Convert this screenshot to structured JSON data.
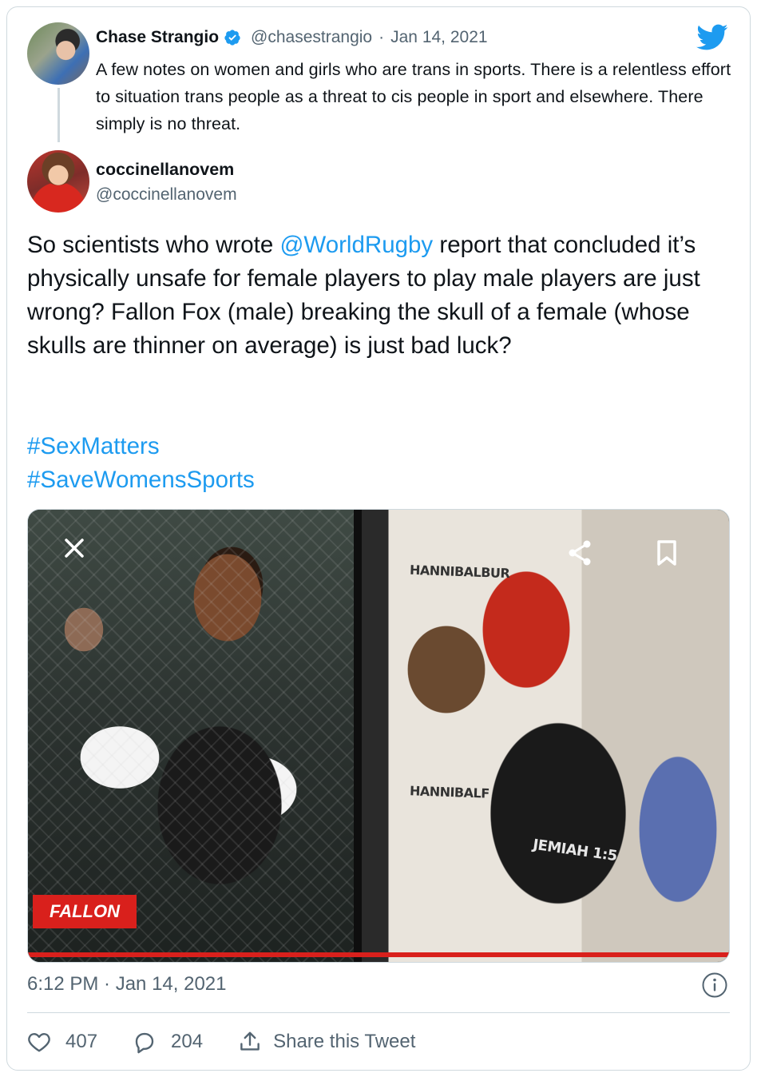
{
  "parent_tweet": {
    "author_name": "Chase Strangio",
    "handle": "@chasestrangio",
    "separator": "·",
    "date": "Jan 14, 2021",
    "text": "A few notes on women and girls who are trans in sports. There is a relentless effort to situation trans people as a threat to cis people in sport and elsewhere. There simply is no threat."
  },
  "main_tweet": {
    "author_name": "coccinellanovem",
    "handle": "@coccinellanovem",
    "text_before_mention": "So scientists who wrote ",
    "mention": "@WorldRugby",
    "text_after_mention": " report that concluded it’s physically unsafe for female players to play male players are just wrong? Fallon Fox (male) breaking the skull of a female (whose skulls are thinner on average) is just bad luck?",
    "hashtags": [
      "#SexMatters",
      "#SaveWomensSports"
    ],
    "media": {
      "sign_top": "HANNIBALBUR",
      "sign_bottom": "HANNIBALF",
      "shirt_text": "JEMIAH 1:5",
      "name_tag": "FALLON"
    },
    "timestamp": "6:12 PM · Jan 14, 2021"
  },
  "actions": {
    "likes": "407",
    "replies": "204",
    "share_label": "Share this Tweet"
  },
  "colors": {
    "link": "#1d9bf0",
    "muted": "#536471",
    "border": "#cfd9de",
    "accent_red": "#d9201c"
  },
  "icons": [
    "verified-badge-icon",
    "twitter-bird-icon",
    "close-icon",
    "share-icon",
    "bookmark-icon",
    "info-icon",
    "heart-icon",
    "reply-icon",
    "upload-icon"
  ]
}
